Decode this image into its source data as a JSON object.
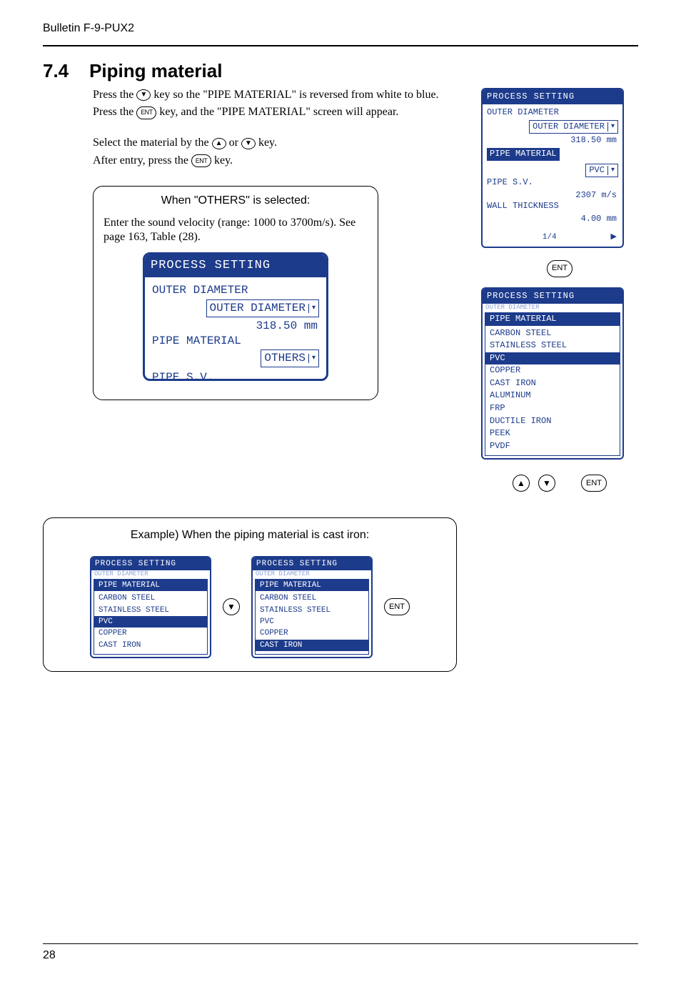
{
  "bulletin": "Bulletin F-9-PUX2",
  "section": {
    "number": "7.4",
    "title": "Piping material"
  },
  "keys": {
    "down": "▼",
    "up": "▲",
    "ent": "ENT"
  },
  "body": {
    "p1a": "Press the ",
    "p1b": " key so the \"PIPE MATERIAL\" is reversed from white to blue.",
    "p2a": "Press the ",
    "p2b": " key, and the \"PIPE MATERIAL\" screen will appear.",
    "p3a": "Select the material by the ",
    "p3b": " or ",
    "p3c": " key.",
    "p4a": "After entry, press the ",
    "p4b": " key."
  },
  "others_panel": {
    "title": "When \"OTHERS\" is selected:",
    "text": "Enter the sound velocity (range: 1000 to 3700m/s).  See page 163, Table (28)."
  },
  "lcd_common": {
    "header": "PROCESS SETTING",
    "outer_diameter_label": "OUTER DIAMETER",
    "outer_diameter_select": "OUTER DIAMETER",
    "outer_diameter_value": "318.50 mm",
    "pipe_material_label": "PIPE MATERIAL",
    "pipe_sv_label": "PIPE S.V.",
    "pipe_sv_value": "2307 m/s",
    "wall_thickness_label": "WALL THICKNESS",
    "wall_thickness_value": "4.00 mm",
    "page_indicator": "1/4"
  },
  "lcd_others_select_value": "OTHERS",
  "lcd_pvc_select_value": "PVC",
  "material_list_full": [
    "CARBON STEEL",
    "STAINLESS STEEL",
    "PVC",
    "COPPER",
    "CAST IRON",
    "ALUMINUM",
    "FRP",
    "DUCTILE IRON",
    "PEEK",
    "PVDF"
  ],
  "material_list_short": [
    "CARBON STEEL",
    "STAINLESS STEEL",
    "PVC",
    "COPPER",
    "CAST IRON"
  ],
  "full_list_selected": "PVC",
  "example": {
    "title": "Example)  When the piping material is cast iron:",
    "left_selected": "PVC",
    "right_selected": "CAST IRON"
  },
  "page_number": "28"
}
